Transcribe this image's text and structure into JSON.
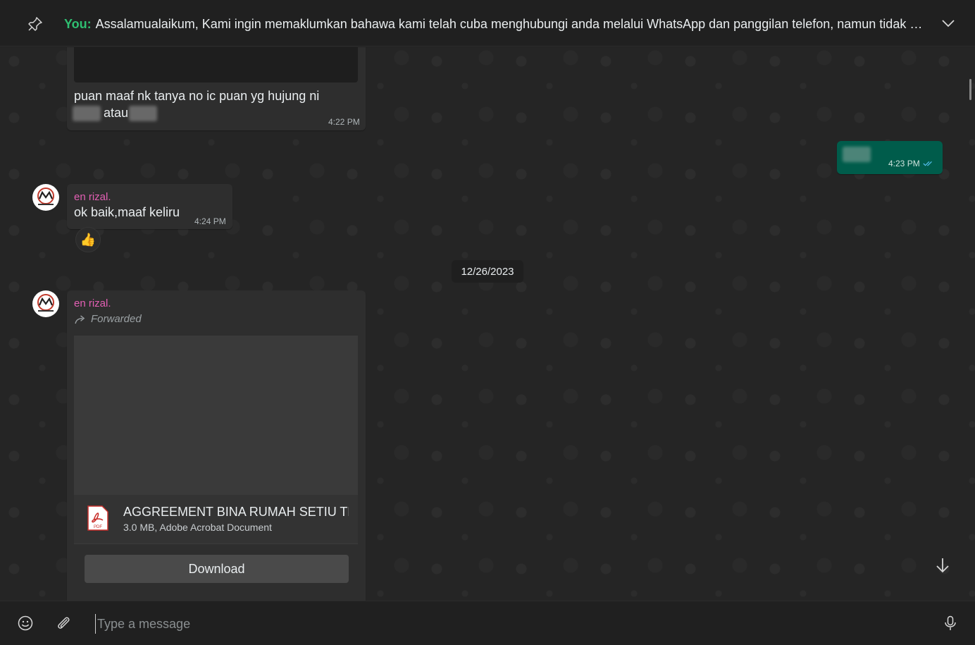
{
  "pinned": {
    "sender_label": "You:",
    "text": "Assalamualaikum,  Kami ingin memaklumkan bahawa kami telah cuba menghubungi anda melalui WhatsApp dan panggilan telefon, namun tidak mener…"
  },
  "messages": {
    "m1": {
      "line1": "puan maaf nk tanya no ic puan yg hujung ni",
      "or_word": "atau",
      "time": "4:22 PM"
    },
    "m2": {
      "time": "4:23 PM"
    },
    "m3": {
      "sender": "en rizal.",
      "text": "ok baik,maaf keliru",
      "time": "4:24 PM",
      "reaction": "👍"
    },
    "date_divider": "12/26/2023",
    "m4": {
      "sender": "en rizal.",
      "forwarded_label": "Forwarded",
      "doc_name": "AGGREEMENT BINA RUMAH SETIU TER...",
      "doc_meta": "3.0 MB, Adobe Acrobat Document",
      "pdf_badge": "PDF",
      "download_label": "Download"
    }
  },
  "composer": {
    "placeholder": "Type a message"
  },
  "colors": {
    "accent_green": "#2fbf71",
    "outgoing_bubble": "#005c4b",
    "sender_name": "#e35fb4",
    "read_ticks": "#53bdeb"
  },
  "icons": [
    "pin-icon",
    "chevron-down-icon",
    "forward-icon",
    "pdf-icon",
    "read-ticks-icon",
    "arrow-down-icon",
    "emoji-icon",
    "attach-icon",
    "mic-icon"
  ]
}
